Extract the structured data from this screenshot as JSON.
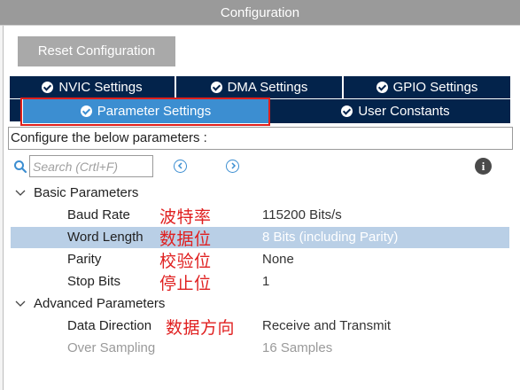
{
  "window": {
    "title": "Configuration"
  },
  "toolbar": {
    "reset_label": "Reset Configuration"
  },
  "tabs": {
    "row1": [
      {
        "label": "NVIC Settings"
      },
      {
        "label": "DMA Settings"
      },
      {
        "label": "GPIO Settings"
      }
    ],
    "row2": [
      {
        "label": "Parameter Settings",
        "active": true
      },
      {
        "label": "User Constants"
      }
    ]
  },
  "description": "Configure the below parameters :",
  "search": {
    "placeholder": "Search (Crtl+F)"
  },
  "icons": {
    "search": "search-icon",
    "prev": "chevron-left-circle-icon",
    "next": "chevron-right-circle-icon",
    "info": "info-icon",
    "tab_check": "check-circle-icon",
    "expand": "chevron-down-icon"
  },
  "colors": {
    "tab_bg": "#03234b",
    "tab_active": "#3c8ed1",
    "highlight_box": "#e0201b",
    "selected_row": "#b9cfe6",
    "annotation": "#e02020"
  },
  "sections": {
    "basic": {
      "title": "Basic Parameters",
      "params": [
        {
          "name": "Baud Rate",
          "value": "115200 Bits/s",
          "note": "波特率"
        },
        {
          "name": "Word Length",
          "value": "8 Bits (including Parity)",
          "note": "数据位",
          "selected": true
        },
        {
          "name": "Parity",
          "value": "None",
          "note": "校验位"
        },
        {
          "name": "Stop Bits",
          "value": "1",
          "note": "停止位"
        }
      ]
    },
    "advanced": {
      "title": "Advanced Parameters",
      "params": [
        {
          "name": "Data Direction",
          "value": "Receive and Transmit",
          "note": "数据方向"
        },
        {
          "name": "Over Sampling",
          "value": "16 Samples",
          "disabled": true
        }
      ]
    }
  }
}
